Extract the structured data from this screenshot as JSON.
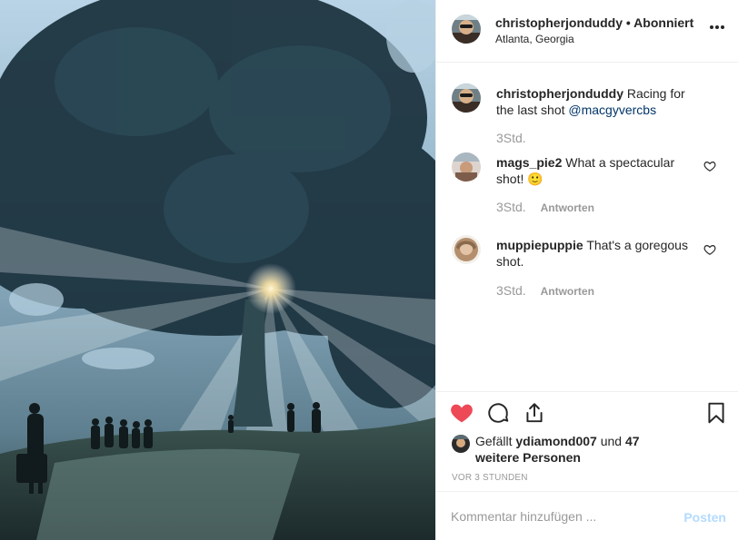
{
  "post": {
    "author": "christopherjonduddy",
    "separator": "•",
    "follow_status": "Abonniert",
    "location": "Atlanta, Georgia",
    "photo_description_icon": "forest-sunrays-photo"
  },
  "caption": {
    "username": "christopherjonduddy",
    "text": "Racing for the last shot",
    "mention": "@macgyvercbs",
    "time": "3Std."
  },
  "comments": [
    {
      "username": "mags_pie2",
      "text": "What a spectacular shot! 🙂",
      "time": "3Std.",
      "reply_label": "Antworten"
    },
    {
      "username": "muppiepuppie",
      "text": "That's a goregous shot.",
      "time": "3Std.",
      "reply_label": "Antworten"
    }
  ],
  "likes": {
    "prefix": "Gefällt",
    "user": "ydiamond007",
    "conjunction": "und",
    "others": "47 weitere Personen"
  },
  "timestamp": "VOR 3 STUNDEN",
  "comment_box": {
    "placeholder": "Kommentar hinzufügen ...",
    "post_label": "Posten"
  },
  "colors": {
    "like_red": "#ed4956",
    "link_blue": "#003569",
    "post_disabled": "#b3dbff",
    "muted": "#999999"
  },
  "icons": [
    "heart-filled-icon",
    "comment-icon",
    "share-icon",
    "bookmark-icon",
    "heart-outline-icon",
    "more-options-icon"
  ]
}
